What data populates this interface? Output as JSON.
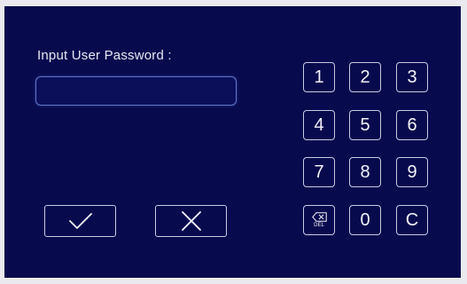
{
  "prompt": "Input User Password :",
  "password": {
    "value": "",
    "placeholder": ""
  },
  "keypad": {
    "keys": [
      "1",
      "2",
      "3",
      "4",
      "5",
      "6",
      "7",
      "8",
      "9",
      "0",
      "C"
    ],
    "delete_label": "DEL"
  },
  "actions": {
    "confirm_icon": "check-icon",
    "cancel_icon": "cross-icon"
  },
  "colors": {
    "background": "#080a4e",
    "border": "#c7cbe0",
    "field_border": "#5e78c8",
    "text": "#e6e8f2"
  }
}
